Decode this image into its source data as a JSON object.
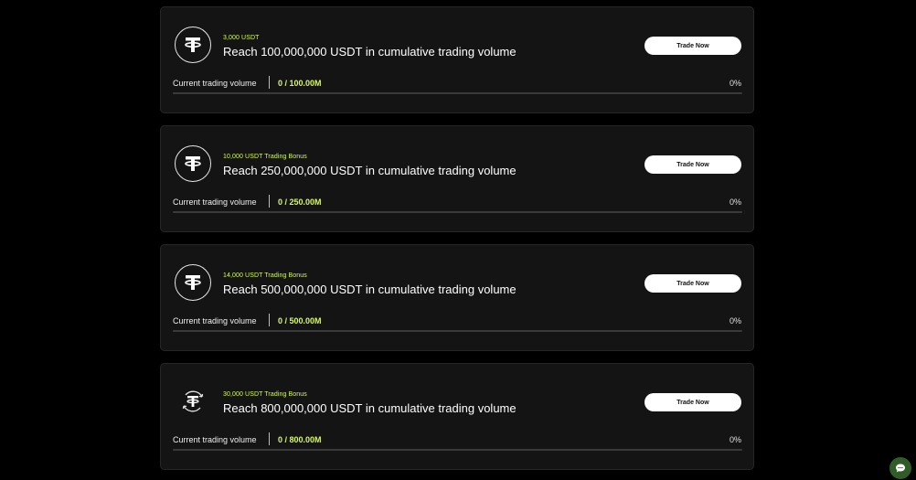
{
  "cards": [
    {
      "reward": "3,000 USDT",
      "goal": "Reach 100,000,000 USDT in cumulative trading volume",
      "button_label": "Trade Now",
      "volume_label": "Current trading volume",
      "volume_value": "0 / 100.00M",
      "percent": "0%",
      "progress": 0,
      "icon": "usdt-icon"
    },
    {
      "reward": "10,000 USDT Trading Bonus",
      "goal": "Reach 250,000,000 USDT in cumulative trading volume",
      "button_label": "Trade Now",
      "volume_label": "Current trading volume",
      "volume_value": "0 / 250.00M",
      "percent": "0%",
      "progress": 0,
      "icon": "usdt-icon"
    },
    {
      "reward": "14,000 USDT Trading Bonus",
      "goal": "Reach 500,000,000 USDT in cumulative trading volume",
      "button_label": "Trade Now",
      "volume_label": "Current trading volume",
      "volume_value": "0 / 500.00M",
      "percent": "0%",
      "progress": 0,
      "icon": "usdt-icon"
    },
    {
      "reward": "30,000 USDT Trading Bonus",
      "goal": "Reach 800,000,000 USDT in cumulative trading volume",
      "button_label": "Trade Now",
      "volume_label": "Current trading volume",
      "volume_value": "0 / 800.00M",
      "percent": "0%",
      "progress": 0,
      "icon": "usdt-bonus-icon"
    }
  ],
  "chat": {
    "icon": "chat-icon"
  },
  "colors": {
    "accent": "#d6f56a",
    "card_bg": "#141414",
    "chat_bg": "#2f5c27"
  }
}
